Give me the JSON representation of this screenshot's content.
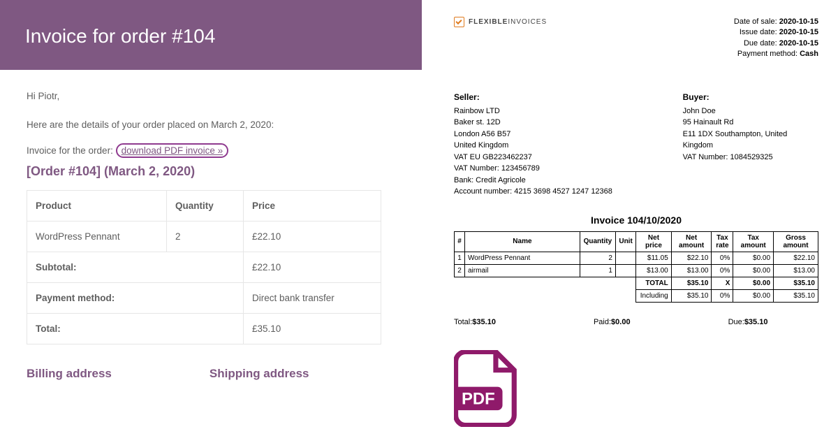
{
  "email": {
    "header_title": "Invoice for order #104",
    "greeting": "Hi Piotr,",
    "intro": "Here are the details of your order placed on March 2, 2020:",
    "invoice_line_prefix": "Invoice for the order: ",
    "download_link_text": "download PDF invoice »",
    "order_heading": "[Order #104] (March 2, 2020)",
    "table": {
      "cols": {
        "product": "Product",
        "quantity": "Quantity",
        "price": "Price"
      },
      "items": [
        {
          "product": "WordPress Pennant",
          "quantity": "2",
          "price": "£22.10"
        }
      ],
      "subtotal_label": "Subtotal:",
      "subtotal_value": "£22.10",
      "payment_label": "Payment method:",
      "payment_value": "Direct bank transfer",
      "total_label": "Total:",
      "total_value": "£35.10"
    },
    "billing_heading": "Billing address",
    "shipping_heading": "Shipping address"
  },
  "invoice": {
    "logo": {
      "text1": "FLEXIBLE",
      "text2": "INVOICES"
    },
    "meta": {
      "sale_label": "Date of sale:",
      "sale_value": "2020-10-15",
      "issue_label": "Issue date:",
      "issue_value": "2020-10-15",
      "due_label": "Due date:",
      "due_value": "2020-10-15",
      "method_label": "Payment method:",
      "method_value": "Cash"
    },
    "seller": {
      "heading": "Seller:",
      "lines": [
        "Rainbow LTD",
        "Baker st. 12D",
        "London A56 B57",
        "United Kingdom",
        "VAT EU GB223462237",
        "VAT Number: 123456789",
        "Bank: Credit Agricole",
        "Account number: 4215 3698 4527 1247 12368"
      ]
    },
    "buyer": {
      "heading": "Buyer:",
      "lines": [
        "John Doe",
        "95 Hainault Rd",
        "E11 1DX Southampton, United Kingdom",
        "VAT Number: 1084529325"
      ]
    },
    "title": "Invoice 104/10/2020",
    "cols": {
      "idx": "#",
      "name": "Name",
      "qty": "Quantity",
      "unit": "Unit",
      "netprice": "Net price",
      "netamount": "Net amount",
      "taxrate": "Tax rate",
      "taxamount": "Tax amount",
      "gross": "Gross amount"
    },
    "rows": [
      {
        "idx": "1",
        "name": "WordPress Pennant",
        "qty": "2",
        "unit": "",
        "netprice": "$11.05",
        "netamount": "$22.10",
        "taxrate": "0%",
        "taxamount": "$0.00",
        "gross": "$22.10"
      },
      {
        "idx": "2",
        "name": "airmail",
        "qty": "1",
        "unit": "",
        "netprice": "$13.00",
        "netamount": "$13.00",
        "taxrate": "0%",
        "taxamount": "$0.00",
        "gross": "$13.00"
      }
    ],
    "total": {
      "label": "TOTAL",
      "netamount": "$35.10",
      "taxrate": "X",
      "taxamount": "$0.00",
      "gross": "$35.10"
    },
    "including": {
      "label": "Including",
      "netamount": "$35.10",
      "taxrate": "0%",
      "taxamount": "$0.00",
      "gross": "$35.10"
    },
    "status": {
      "total_label": "Total:",
      "total_value": "$35.10",
      "paid_label": "Paid:",
      "paid_value": "$0.00",
      "due_label": "Due:",
      "due_value": "$35.10"
    },
    "pdf_badge": "PDF"
  }
}
